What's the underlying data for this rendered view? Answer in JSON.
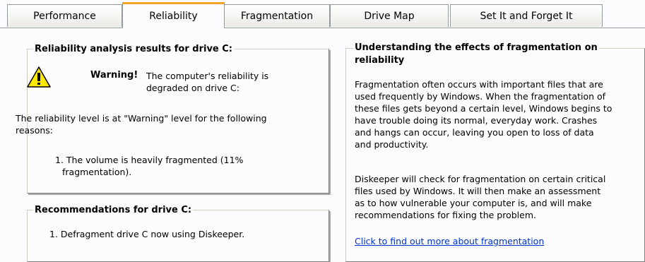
{
  "tabs": [
    {
      "label": "Performance"
    },
    {
      "label": "Reliability"
    },
    {
      "label": "Fragmentation"
    },
    {
      "label": "Drive Map"
    },
    {
      "label": "Set It and Forget It"
    }
  ],
  "active_tab": "Reliability",
  "reliability": {
    "title": "Reliability analysis results for drive C:",
    "warning_label": "Warning!",
    "warning_text_1": "The computer's reliability is",
    "warning_text_2": "degraded on drive C:",
    "level_text_1": "The reliability level is at \"Warning\" level for the following",
    "level_text_2": "reasons:",
    "reason_1a": "1. The volume is heavily fragmented (11%",
    "reason_1b": "fragmentation)."
  },
  "recommendations": {
    "title": "Recommendations for drive C:",
    "item_1": "1. Defragment drive C now using Diskeeper."
  },
  "understanding": {
    "title_1": "Understanding the effects of fragmentation on",
    "title_2": "reliability",
    "p1": [
      "Fragmentation often occurs with important files that are",
      "used frequently by Windows.  When the fragmentation of",
      "these files gets beyond a certain level, Windows begins to",
      "have trouble doing its normal, everyday work.  Crashes",
      "and hangs can occur, leaving you open to loss of data",
      "and productivity."
    ],
    "p2": [
      "Diskeeper will check for fragmentation on certain critical",
      "files used by Windows.  It will then make an assessment",
      "as to how vulnerable your computer is, and will make",
      "recommendations for fixing the problem."
    ],
    "link": "Click to find out more about fragmentation"
  },
  "icons": {
    "warning": "warning-icon"
  },
  "colors": {
    "active_tab_accent": "#f5a42b",
    "link": "#0033cc",
    "icon_yellow": "#ffe800"
  }
}
